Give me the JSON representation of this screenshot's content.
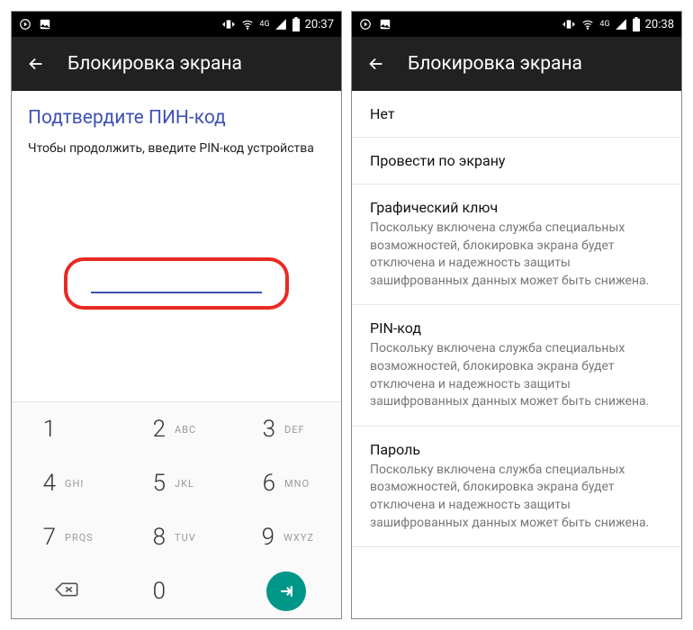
{
  "left": {
    "statusbar_time": "20:37",
    "appbar_title": "Блокировка экрана",
    "pin_title": "Подтвердите ПИН-код",
    "pin_subtitle": "Чтобы продолжить, введите PIN-код устройства",
    "keypad": {
      "k1": {
        "d": "1",
        "l": ""
      },
      "k2": {
        "d": "2",
        "l": "ABC"
      },
      "k3": {
        "d": "3",
        "l": "DEF"
      },
      "k4": {
        "d": "4",
        "l": "GHI"
      },
      "k5": {
        "d": "5",
        "l": "JKL"
      },
      "k6": {
        "d": "6",
        "l": "MNO"
      },
      "k7": {
        "d": "7",
        "l": "PRQS"
      },
      "k8": {
        "d": "8",
        "l": "TUV"
      },
      "k9": {
        "d": "9",
        "l": "WXYZ"
      },
      "k0": {
        "d": "0",
        "l": ""
      }
    }
  },
  "right": {
    "statusbar_time": "20:38",
    "appbar_title": "Блокировка экрана",
    "options": {
      "none": {
        "title": "Нет",
        "desc": ""
      },
      "swipe": {
        "title": "Провести по экрану",
        "desc": ""
      },
      "pattern": {
        "title": "Графический ключ",
        "desc": "Поскольку включена служба специальных возможностей, блокировка экрана будет отключена и надежность защиты зашифрованных данных может быть снижена."
      },
      "pin": {
        "title": "PIN-код",
        "desc": "Поскольку включена служба специальных возможностей, блокировка экрана будет отключена и надежность защиты зашифрованных данных может быть снижена."
      },
      "pass": {
        "title": "Пароль",
        "desc": "Поскольку включена служба специальных возможностей, блокировка экрана будет отключена и надежность защиты зашифрованных данных может быть снижена."
      }
    }
  }
}
